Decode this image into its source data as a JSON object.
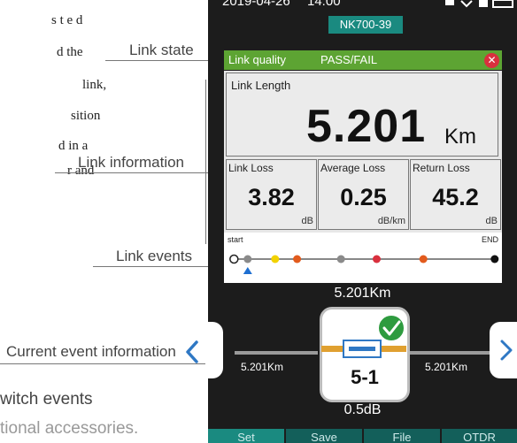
{
  "manual": {
    "lines": [
      "s t e d",
      "d the",
      "link,",
      "sition",
      "d in a",
      "r and"
    ],
    "callouts": {
      "link_state": "Link state",
      "link_information": "Link information",
      "link_events": "Link events",
      "current_event_information": "Current event information"
    },
    "bottom_lines": [
      "witch events",
      "tional accessories."
    ]
  },
  "device": {
    "status_bar": {
      "date": "2019-04-26",
      "time": "14:00"
    },
    "model_tab": "NK700-39",
    "link_quality": {
      "label": "Link quality",
      "value": "PASS/FAIL"
    },
    "link_length": {
      "label": "Link Length",
      "value": "5.201",
      "unit": "Km"
    },
    "stats": [
      {
        "label": "Link Loss",
        "value": "3.82",
        "unit": "dB"
      },
      {
        "label": "Average Loss",
        "value": "0.25",
        "unit": "dB/km"
      },
      {
        "label": "Return Loss",
        "value": "45.2",
        "unit": "dB"
      }
    ],
    "events": {
      "start_label": "start",
      "end_label": "END",
      "dots": [
        {
          "position": 0.03,
          "color": "#ffffff",
          "hollow": true
        },
        {
          "position": 0.08,
          "color": "#8a8a8a"
        },
        {
          "position": 0.18,
          "color": "#f2d200"
        },
        {
          "position": 0.26,
          "color": "#e25b1d"
        },
        {
          "position": 0.42,
          "color": "#8a8a8a"
        },
        {
          "position": 0.55,
          "color": "#d9303e"
        },
        {
          "position": 0.72,
          "color": "#e25b1d"
        },
        {
          "position": 0.98,
          "color": "#111111"
        }
      ],
      "selected_index": 1,
      "marker_color": "#1e6fd1"
    },
    "current_event": {
      "distance": "5.201Km",
      "left_distance": "5.201Km",
      "right_distance": "5.201Km",
      "event_id": "5-1",
      "loss": "0.5dB",
      "status": "pass"
    },
    "menu": [
      "Set",
      "Save",
      "File",
      "OTDR"
    ],
    "colors": {
      "accent": "#1a8a80",
      "pass": "#5da433",
      "fail": "#d9303e",
      "fiber": "#e0a030",
      "connector": "#2f78c4",
      "nav": "#2f78c4"
    }
  }
}
